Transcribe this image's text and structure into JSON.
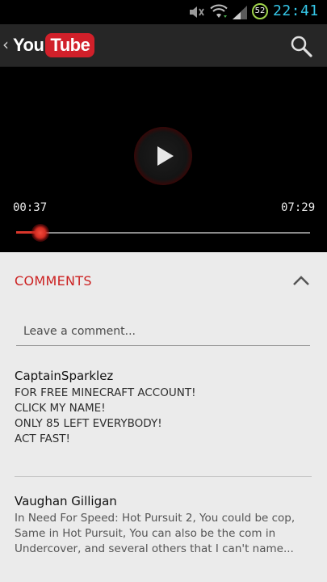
{
  "status_bar": {
    "battery_level": "52",
    "time": "22:41",
    "icons": [
      "mute-icon",
      "wifi-icon",
      "signal-icon",
      "battery-icon"
    ]
  },
  "app_bar": {
    "logo_you": "You",
    "logo_tube": "Tube",
    "brand_color": "#d1202a",
    "back_icon": "chevron-left-icon",
    "search_icon": "search-icon"
  },
  "player": {
    "current_time": "00:37",
    "total_time": "07:29",
    "progress_fraction": 0.082,
    "accent_color": "#d9362b"
  },
  "comments": {
    "header": "COMMENTS",
    "header_color": "#cc2222",
    "input_placeholder": "Leave a comment...",
    "items": [
      {
        "author": "CaptainSparklez",
        "lines": [
          "FOR FREE MINECRAFT ACCOUNT!",
          "CLICK MY NAME!",
          "ONLY 85 LEFT EVERYBODY!",
          "ACT FAST!"
        ]
      },
      {
        "author": "Vaughan Gilligan",
        "lines": [
          "In Need For Speed: Hot Pursuit 2, You could be cop,",
          "Same in Hot Pursuit, You can also be the com in",
          "Undercover, and several others that I can't name..."
        ]
      }
    ]
  }
}
